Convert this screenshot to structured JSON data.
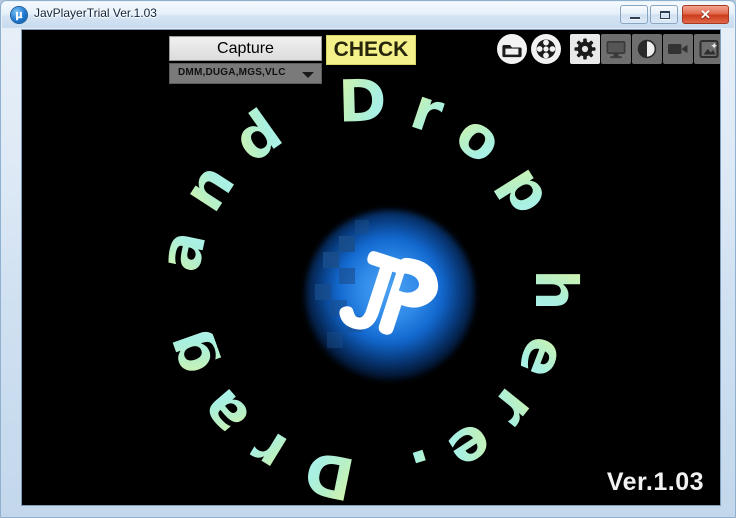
{
  "window": {
    "title": "JavPlayerTrial Ver.1.03",
    "app_icon": "jp-logo-icon",
    "controls": {
      "minimize_label": "Minimize",
      "maximize_label": "Maximize",
      "close_label": "✕"
    }
  },
  "toolbar": {
    "capture_label": "Capture",
    "check_label": "CHECK",
    "source_select": {
      "value": "DMM,DUGA,MGS,VLC",
      "options": [
        "DMM,DUGA,MGS,VLC"
      ]
    },
    "icons": [
      {
        "name": "folder-open-icon",
        "shape": "round",
        "tone": "white"
      },
      {
        "name": "film-reel-icon",
        "shape": "round",
        "tone": "white"
      },
      {
        "name": "gear-settings-icon",
        "shape": "square",
        "tone": "light"
      },
      {
        "name": "monitor-display-icon",
        "shape": "square",
        "tone": "gray"
      },
      {
        "name": "contrast-brightness-icon",
        "shape": "square",
        "tone": "gray"
      },
      {
        "name": "video-camera-icon",
        "shape": "square",
        "tone": "gray"
      },
      {
        "name": "add-image-icon",
        "shape": "square",
        "tone": "gray"
      }
    ]
  },
  "drop_area": {
    "ring_text": "Drop here. Drag and ",
    "logo_text": "JP",
    "version_label": "Ver.1.03"
  },
  "colors": {
    "background": "#000000",
    "accent_yellow": "#f4f08a",
    "orb_blue": "#1268cf",
    "ring_gradient_start": "#d9f5a8",
    "ring_gradient_end": "#b6f2ee",
    "frame_blue": "#c3d7ec"
  }
}
